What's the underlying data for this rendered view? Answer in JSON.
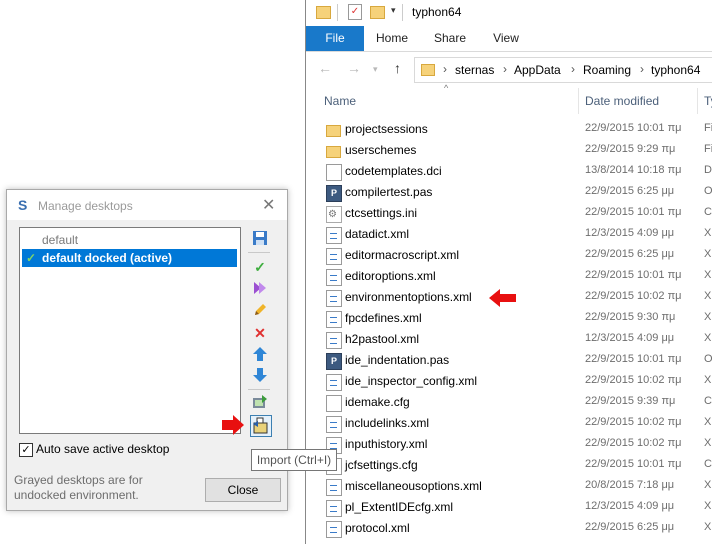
{
  "explorer": {
    "title": "typhon64",
    "tabs": [
      "File",
      "Home",
      "Share",
      "View"
    ],
    "address": [
      "sternas",
      "AppData",
      "Roaming",
      "typhon64"
    ],
    "columns": {
      "name": "Name",
      "date": "Date modified",
      "type": "Ty"
    },
    "files": [
      {
        "name": "projectsessions",
        "date": "22/9/2015 10:01 πμ",
        "type": "Fi",
        "icon": "folder-icon"
      },
      {
        "name": "userschemes",
        "date": "22/9/2015 9:29 πμ",
        "type": "Fi",
        "icon": "folder-icon"
      },
      {
        "name": "codetemplates.dci",
        "date": "13/8/2014 10:18 πμ",
        "type": "D",
        "icon": "file-icon"
      },
      {
        "name": "compilertest.pas",
        "date": "22/9/2015 6:25 μμ",
        "type": "O",
        "icon": "pascal-file-icon"
      },
      {
        "name": "ctcsettings.ini",
        "date": "22/9/2015 10:01 πμ",
        "type": "C",
        "icon": "settings-file-icon"
      },
      {
        "name": "datadict.xml",
        "date": "12/3/2015 4:09 μμ",
        "type": "X",
        "icon": "xml-file-icon"
      },
      {
        "name": "editormacroscript.xml",
        "date": "22/9/2015 6:25 μμ",
        "type": "X",
        "icon": "xml-file-icon"
      },
      {
        "name": "editoroptions.xml",
        "date": "22/9/2015 10:01 πμ",
        "type": "X",
        "icon": "xml-file-icon"
      },
      {
        "name": "environmentoptions.xml",
        "date": "22/9/2015 10:02 πμ",
        "type": "X",
        "icon": "xml-file-icon"
      },
      {
        "name": "fpcdefines.xml",
        "date": "22/9/2015 9:30 πμ",
        "type": "X",
        "icon": "xml-file-icon"
      },
      {
        "name": "h2pastool.xml",
        "date": "12/3/2015 4:09 μμ",
        "type": "X",
        "icon": "xml-file-icon"
      },
      {
        "name": "ide_indentation.pas",
        "date": "22/9/2015 10:01 πμ",
        "type": "O",
        "icon": "pascal-file-icon"
      },
      {
        "name": "ide_inspector_config.xml",
        "date": "22/9/2015 10:02 πμ",
        "type": "X",
        "icon": "xml-file-icon"
      },
      {
        "name": "idemake.cfg",
        "date": "22/9/2015 9:39 πμ",
        "type": "C",
        "icon": "file-icon"
      },
      {
        "name": "includelinks.xml",
        "date": "22/9/2015 10:02 πμ",
        "type": "X",
        "icon": "xml-file-icon"
      },
      {
        "name": "inputhistory.xml",
        "date": "22/9/2015 10:02 πμ",
        "type": "X",
        "icon": "xml-file-icon"
      },
      {
        "name": "jcfsettings.cfg",
        "date": "22/9/2015 10:01 πμ",
        "type": "C",
        "icon": "file-icon"
      },
      {
        "name": "miscellaneousoptions.xml",
        "date": "20/8/2015 7:18 μμ",
        "type": "X",
        "icon": "xml-file-icon"
      },
      {
        "name": "pl_ExtentIDEcfg.xml",
        "date": "12/3/2015 4:09 μμ",
        "type": "X",
        "icon": "xml-file-icon"
      },
      {
        "name": "protocol.xml",
        "date": "22/9/2015 6:25 μμ",
        "type": "X",
        "icon": "xml-file-icon"
      }
    ]
  },
  "dialog": {
    "title": "Manage desktops",
    "desktops": [
      {
        "label": "default",
        "active": false
      },
      {
        "label": "default docked (active)",
        "active": true
      }
    ],
    "autosave_label": "Auto save active desktop",
    "autosave_checked": true,
    "note": "Grayed desktops are for undocked environment.",
    "close_label": "Close",
    "tooltip": "Import (Ctrl+I)"
  },
  "colors": {
    "accent": "#1979ca",
    "selection": "#0078d7",
    "arrow": "#e81010"
  }
}
